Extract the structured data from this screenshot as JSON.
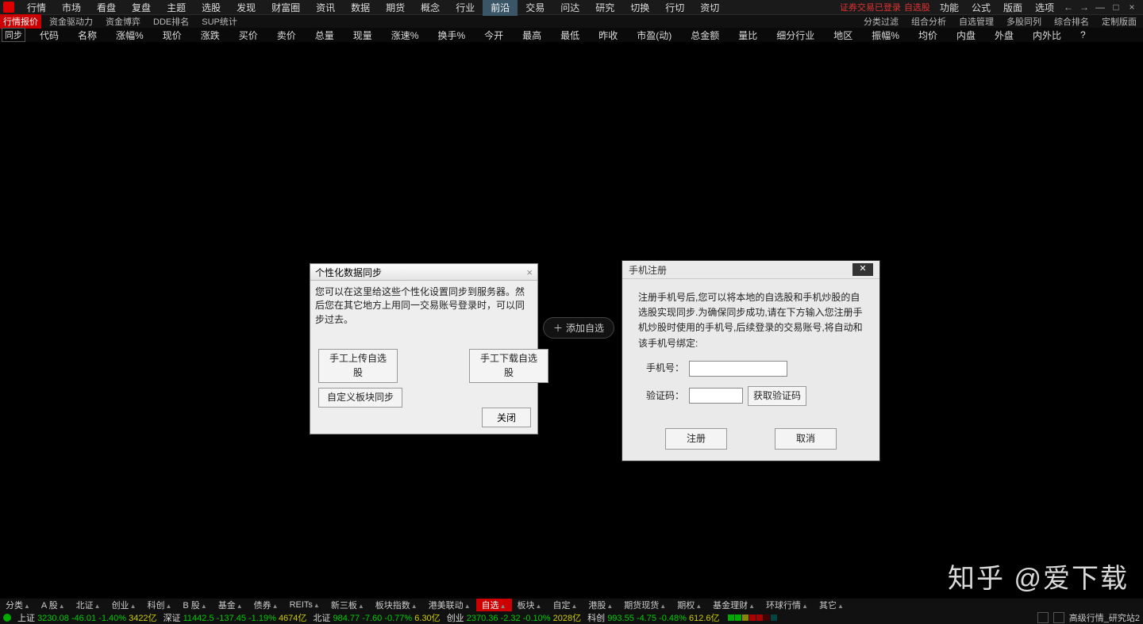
{
  "topmenu": [
    "行情",
    "市场",
    "看盘",
    "复盘",
    "主题",
    "选股",
    "发现",
    "财富圈",
    "资讯",
    "数据",
    "期货",
    "概念",
    "行业",
    "前沿",
    "交易",
    "问达",
    "研究",
    "切换",
    "行切",
    "资切"
  ],
  "topmenu_active_index": 13,
  "login_warning": "证券交易已登录",
  "login_warning2": "自选股",
  "rightmenu": [
    "功能",
    "公式",
    "版面",
    "选项"
  ],
  "nav_icons": [
    "←",
    "→",
    "—",
    "□",
    "×"
  ],
  "row2_left_tag": "行情报价",
  "row2_left": [
    "资金驱动力",
    "资金博弈",
    "DDE排名",
    "SUP统计"
  ],
  "row2_right": [
    "分类过滤",
    "组合分析",
    "自选管理",
    "多股同列",
    "综合排名",
    "定制版面"
  ],
  "sync_button": "同步",
  "columns": [
    "代码",
    "名称",
    "涨幅%",
    "现价",
    "涨跌",
    "买价",
    "卖价",
    "总量",
    "现量",
    "涨速%",
    "换手%",
    "今开",
    "最高",
    "最低",
    "昨收",
    "市盈(动)",
    "总金额",
    "量比",
    "细分行业",
    "地区",
    "振幅%",
    "均价",
    "内盘",
    "外盘",
    "内外比"
  ],
  "help_glyph": "?",
  "add_self_label": "添加自选",
  "dialog1": {
    "title": "个性化数据同步",
    "desc": "您可以在这里给这些个性化设置同步到服务器。然后您在其它地方上用同一交易账号登录时，可以同步过去。",
    "btn_upload": "手工上传自选股",
    "btn_download": "手工下载自选股",
    "btn_custom": "自定义板块同步",
    "btn_close": "关闭"
  },
  "dialog2": {
    "title": "手机注册",
    "desc": "注册手机号后,您可以将本地的自选股和手机炒股的自选股实现同步.为确保同步成功,请在下方输入您注册手机炒股时使用的手机号,后续登录的交易账号,将自动和该手机号绑定:",
    "phone_label": "手机号：",
    "code_label": "验证码：",
    "get_code": "获取验证码",
    "btn_register": "注册",
    "btn_cancel": "取消",
    "close": "✕"
  },
  "bottom_tabs": [
    "分类",
    "A 股",
    "北证",
    "创业",
    "科创",
    "B 股",
    "基金",
    "债券",
    "REITs",
    "新三板",
    "板块指数",
    "港美联动",
    "自选",
    "板块",
    "自定",
    "港股",
    "期货现货",
    "期权",
    "基金理财",
    "环球行情",
    "其它"
  ],
  "bottom_sel_index": 12,
  "indices": [
    {
      "name": "上证",
      "value": "3230.08",
      "chg": "-46.01",
      "pct": "-1.40%",
      "amt": "3422亿",
      "dir": "dn"
    },
    {
      "name": "深证",
      "value": "11442.5",
      "chg": "-137.45",
      "pct": "-1.19%",
      "amt": "4674亿",
      "dir": "dn"
    },
    {
      "name": "北证",
      "value": "984.77",
      "chg": "-7.60",
      "pct": "-0.77%",
      "amt": "6.30亿",
      "dir": "dn"
    },
    {
      "name": "创业",
      "value": "2370.36",
      "chg": "-2.32",
      "pct": "-0.10%",
      "amt": "2028亿",
      "dir": "dn"
    },
    {
      "name": "科创",
      "value": "993.55",
      "chg": "-4.75",
      "pct": "-0.48%",
      "amt": "612.6亿",
      "dir": "dn"
    }
  ],
  "status_right_text": "高级行情_研究站2",
  "watermark": "知乎 @爱下载",
  "plus": "＋"
}
